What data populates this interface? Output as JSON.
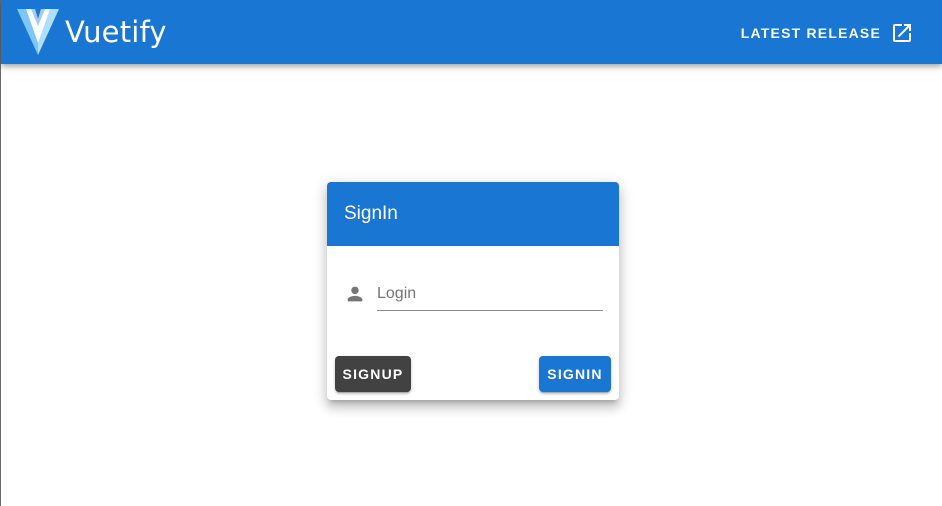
{
  "app_bar": {
    "brand": "Vuetify",
    "logo_icon": "vuetify-logo-icon",
    "release_label": "LATEST RELEASE",
    "release_icon": "open-in-new-icon"
  },
  "signin_card": {
    "title": "SignIn",
    "login_field": {
      "icon": "person-icon",
      "placeholder": "Login",
      "value": ""
    },
    "signup_label": "SIGNUP",
    "signin_label": "SIGNIN"
  },
  "colors": {
    "primary": "#1976d2",
    "secondary_button": "#424242",
    "background": "#ffffff"
  }
}
